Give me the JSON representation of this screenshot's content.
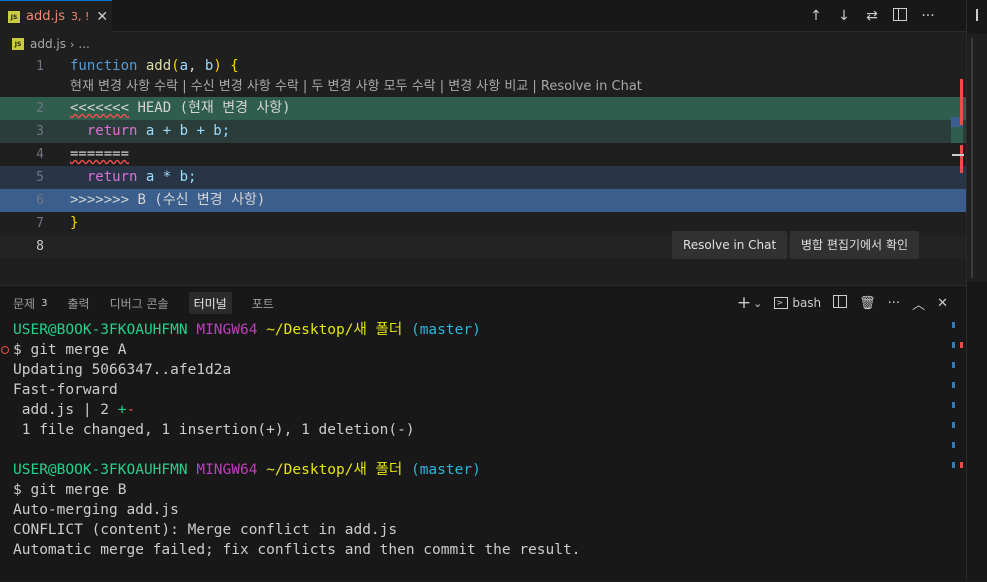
{
  "tab": {
    "icon": "JS",
    "name": "add.js",
    "status": "3, !",
    "close": "✕"
  },
  "editor_actions": {
    "prev": "↑",
    "next": "↓",
    "compare": "⇄",
    "more": "···"
  },
  "breadcrumb": {
    "file": "add.js",
    "more": "..."
  },
  "code": {
    "line_numbers": [
      "1",
      "2",
      "3",
      "4",
      "5",
      "6",
      "7",
      "8"
    ],
    "codelens": "현재 변경 사항 수락 | 수신 변경 사항 수락 | 두 변경 사항 모두 수락 | 변경 사항 비교 | Resolve in Chat",
    "l1_kw": "function",
    "l1_fn": "add",
    "l1_open": "(",
    "l1_a": "a",
    "l1_comma": ", ",
    "l1_b": "b",
    "l1_close": ")",
    "l1_brace": "{",
    "l2_marker": "<<<<<<<",
    "l2_rest": " HEAD (현재 변경 사항)",
    "l3_kw": "return",
    "l3_expr": " a + b + b;",
    "l4_marker": "=======",
    "l5_kw": "return",
    "l5_expr": " a * b;",
    "l6_marker": ">>>>>>>",
    "l6_rest": " B (수신 변경 사항)",
    "l7_brace": "}"
  },
  "merge_buttons": {
    "resolve_chat": "Resolve in Chat",
    "merge_editor": "병합 편집기에서 확인"
  },
  "panel": {
    "tabs": [
      {
        "label": "문제",
        "badge": "3"
      },
      {
        "label": "출력"
      },
      {
        "label": "디버그 콘솔"
      },
      {
        "label": "터미널"
      },
      {
        "label": "포트"
      }
    ],
    "actions": {
      "add": "+",
      "chevron": "⌄",
      "shell": "bash",
      "more": "···",
      "maximize": "︿",
      "close": "✕"
    }
  },
  "terminal": {
    "prompt_user": "USER@BOOK-3FKOAUHFMN",
    "prompt_env": "MINGW64",
    "prompt_path": "~/Desktop/새 폴더",
    "prompt_branch": "(master)",
    "cmd1": "$ git merge A",
    "out1": "Updating 5066347..afe1d2a",
    "out2": "Fast-forward",
    "out3_file": " add.js | 2 ",
    "out3_plus": "+",
    "out3_minus": "-",
    "out4": " 1 file changed, 1 insertion(+), 1 deletion(-)",
    "cmd2": "$ git merge B",
    "out5": "Auto-merging add.js",
    "out6": "CONFLICT (content): Merge conflict in add.js",
    "out7": "Automatic merge failed; fix conflicts and then commit the result."
  }
}
